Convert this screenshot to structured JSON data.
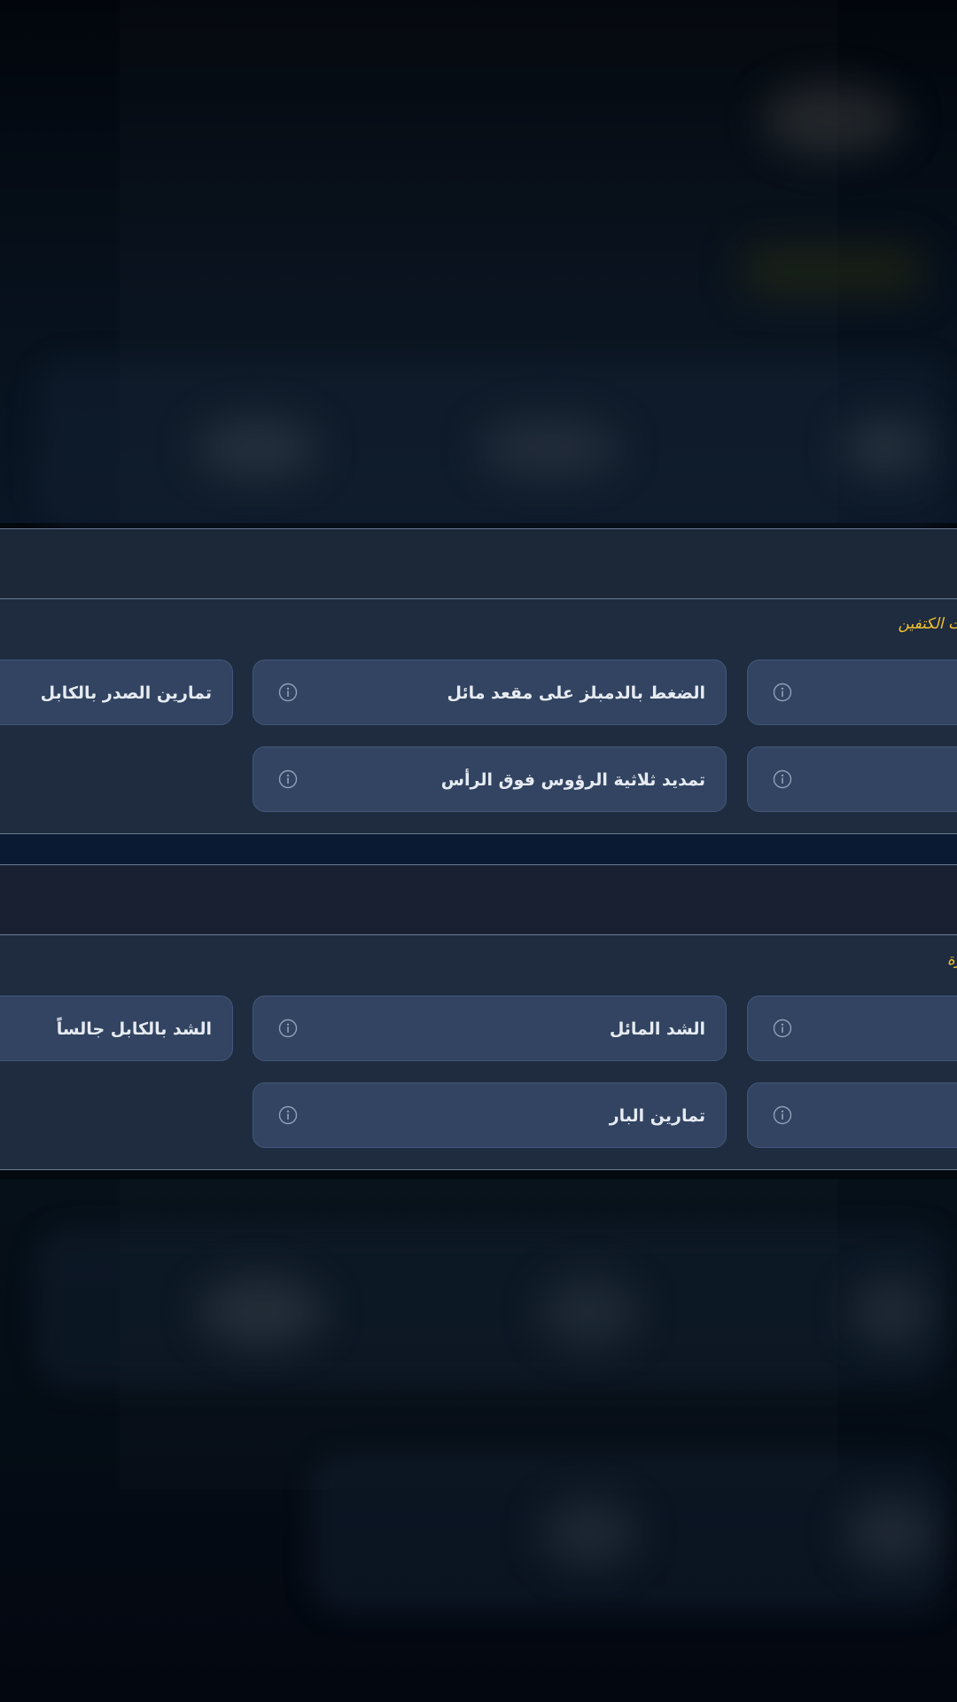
{
  "colors": {
    "accent": "#f2c230",
    "panel": "#1f2c3f",
    "tile": "#324461",
    "text": "#e6ebf2"
  },
  "sections": [
    {
      "subtitle": "ت الكتفين",
      "exercises": [
        {
          "label": "تمارين الصدر بالكابل",
          "icon": "info-icon"
        },
        {
          "label": "الضغط بالدمبلز على مقعد مائل",
          "icon": "info-icon"
        },
        {
          "label": "",
          "icon": "info-icon"
        },
        {
          "label": "تمديد ثلاثية الرؤوس فوق الرأس",
          "icon": "info-icon"
        },
        {
          "label": "",
          "icon": "info-icon"
        }
      ]
    },
    {
      "subtitle": "رة",
      "exercises": [
        {
          "label": "الشد بالكابل جالساً",
          "icon": "info-icon"
        },
        {
          "label": "الشد المائل",
          "icon": "info-icon"
        },
        {
          "label": "",
          "icon": "info-icon"
        },
        {
          "label": "تمارين البار",
          "icon": "info-icon"
        },
        {
          "label": "",
          "icon": "info-icon"
        }
      ]
    }
  ]
}
